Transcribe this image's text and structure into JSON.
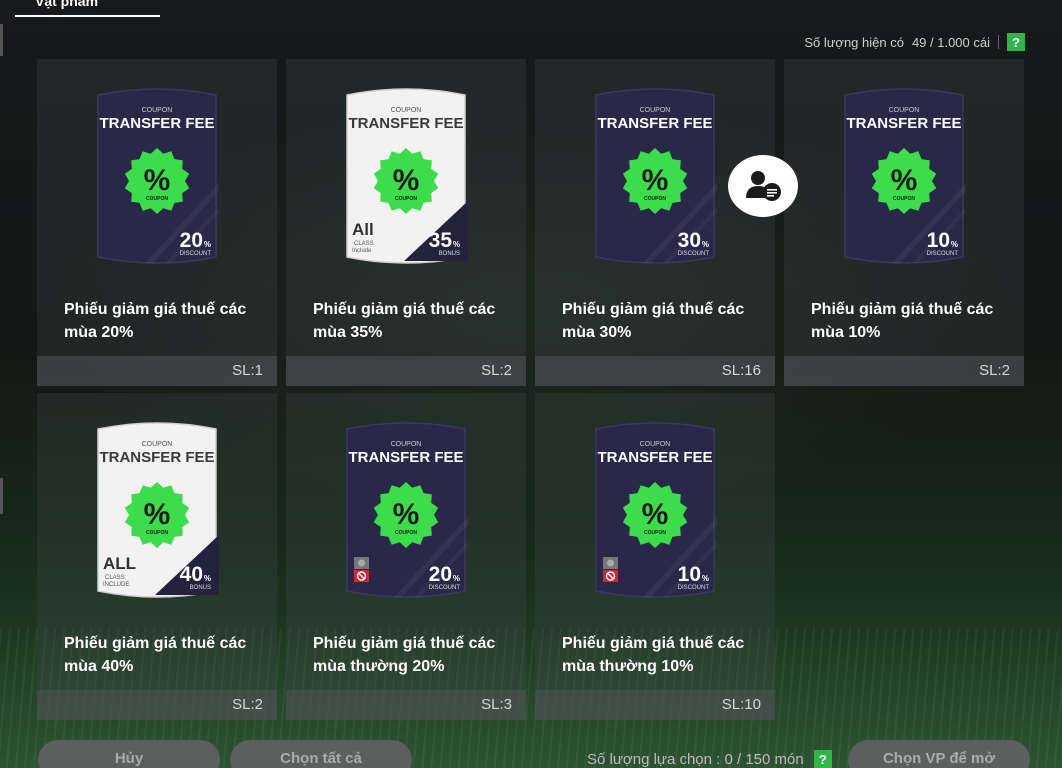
{
  "tab": {
    "label": "Vật phẩm"
  },
  "top": {
    "quantity_label": "Số lượng hiện có",
    "quantity_value": "49 / 1.000 cái",
    "help": "?"
  },
  "items": [
    {
      "name": "Phiếu giảm giá thuế các mùa 20%",
      "qty": "SL:1",
      "coupon": {
        "header": "COUPON",
        "title": "TRANSFER FEE",
        "value": "20",
        "suffix": "%",
        "sub": "DISCOUNT",
        "style": "dark",
        "badge": "%",
        "badge_sub": "COUPON"
      }
    },
    {
      "name": "Phiếu giảm giá thuế các mùa 35%",
      "qty": "SL:2",
      "coupon": {
        "header": "COUPON",
        "title": "TRANSFER FEE",
        "value": "35",
        "suffix": "%",
        "sub": "BONUS",
        "style": "light",
        "badge": "%",
        "badge_sub": "COUPON",
        "all": "All",
        "all_sub1": "CLASS",
        "all_sub2": "Include"
      }
    },
    {
      "name": "Phiếu giảm giá thuế các mùa 30%",
      "qty": "SL:16",
      "coupon": {
        "header": "COUPON",
        "title": "TRANSFER FEE",
        "value": "30",
        "suffix": "%",
        "sub": "DISCOUNT",
        "style": "dark",
        "badge": "%",
        "badge_sub": "COUPON"
      }
    },
    {
      "name": "Phiếu giảm giá thuế các mùa 10%",
      "qty": "SL:2",
      "coupon": {
        "header": "COUPON",
        "title": "TRANSFER FEE",
        "value": "10",
        "suffix": "%",
        "sub": "DISCOUNT",
        "style": "dark",
        "badge": "%",
        "badge_sub": "COUPON"
      }
    },
    {
      "name": "Phiếu giảm giá thuế các mùa 40%",
      "qty": "SL:2",
      "coupon": {
        "header": "COUPON",
        "title": "TRANSFER FEE",
        "value": "40",
        "suffix": "%",
        "sub": "BONUS",
        "style": "light",
        "badge": "%",
        "badge_sub": "COUPON",
        "all": "ALL",
        "all_sub1": "CLASS",
        "all_sub2": "INCLUDE"
      }
    },
    {
      "name": "Phiếu giảm giá thuế các mùa thường 20%",
      "qty": "SL:3",
      "coupon": {
        "header": "COUPON",
        "title": "TRANSFER FEE",
        "value": "20",
        "suffix": "%",
        "sub": "DISCOUNT",
        "style": "dark",
        "badge": "%",
        "badge_sub": "COUPON",
        "restricted": true
      }
    },
    {
      "name": "Phiếu giảm giá thuế các mùa thường 10%",
      "qty": "SL:10",
      "coupon": {
        "header": "COUPON",
        "title": "TRANSFER FEE",
        "value": "10",
        "suffix": "%",
        "sub": "DISCOUNT",
        "style": "dark",
        "badge": "%",
        "badge_sub": "COUPON",
        "restricted": true
      }
    }
  ],
  "bottom": {
    "cancel": "Hủy",
    "select_all": "Chọn tất cả",
    "selection_label": "Số lượng lựa chọn : 0 / 150 món",
    "help": "?",
    "open": "Chọn VP để mở"
  },
  "colors": {
    "accent": "#31b54b",
    "badge": "#3ddc4a",
    "card_dark": "#2a2848",
    "card_light": "#f2f2f2"
  },
  "icons": {
    "chat": "user-chat-icon",
    "restricted": "ban-icon"
  }
}
